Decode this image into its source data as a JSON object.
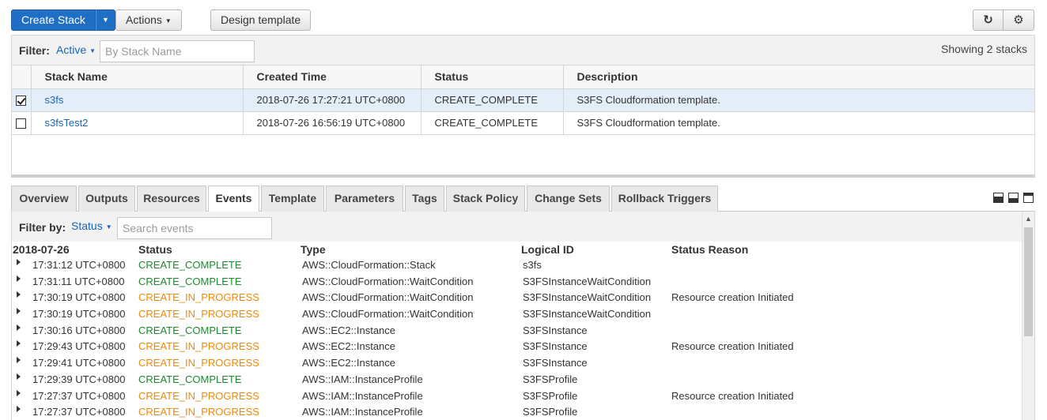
{
  "toolbar": {
    "create_stack": "Create Stack",
    "actions": "Actions",
    "design_template": "Design template"
  },
  "stacks_filter": {
    "label": "Filter:",
    "value": "Active",
    "placeholder": "By Stack Name",
    "showing": "Showing 2 stacks"
  },
  "stacks_table": {
    "columns": [
      "Stack Name",
      "Created Time",
      "Status",
      "Description"
    ],
    "rows": [
      {
        "selected": true,
        "name": "s3fs",
        "created": "2018-07-26 17:27:21 UTC+0800",
        "status": "CREATE_COMPLETE",
        "description": "S3FS Cloudformation template."
      },
      {
        "selected": false,
        "name": "s3fsTest2",
        "created": "2018-07-26 16:56:19 UTC+0800",
        "status": "CREATE_COMPLETE",
        "description": "S3FS Cloudformation template."
      }
    ]
  },
  "tabs": [
    "Overview",
    "Outputs",
    "Resources",
    "Events",
    "Template",
    "Parameters",
    "Tags",
    "Stack Policy",
    "Change Sets",
    "Rollback Triggers"
  ],
  "active_tab": "Events",
  "events_filter": {
    "label": "Filter by:",
    "value": "Status",
    "placeholder": "Search events"
  },
  "events_table": {
    "date": "2018-07-26",
    "columns": [
      "Status",
      "Type",
      "Logical ID",
      "Status Reason"
    ],
    "rows": [
      {
        "time": "17:31:12 UTC+0800",
        "status": "CREATE_COMPLETE",
        "type": "AWS::CloudFormation::Stack",
        "logical_id": "s3fs",
        "reason": ""
      },
      {
        "time": "17:31:11 UTC+0800",
        "status": "CREATE_COMPLETE",
        "type": "AWS::CloudFormation::WaitCondition",
        "logical_id": "S3FSInstanceWaitCondition",
        "reason": ""
      },
      {
        "time": "17:30:19 UTC+0800",
        "status": "CREATE_IN_PROGRESS",
        "type": "AWS::CloudFormation::WaitCondition",
        "logical_id": "S3FSInstanceWaitCondition",
        "reason": "Resource creation Initiated"
      },
      {
        "time": "17:30:19 UTC+0800",
        "status": "CREATE_IN_PROGRESS",
        "type": "AWS::CloudFormation::WaitCondition",
        "logical_id": "S3FSInstanceWaitCondition",
        "reason": ""
      },
      {
        "time": "17:30:16 UTC+0800",
        "status": "CREATE_COMPLETE",
        "type": "AWS::EC2::Instance",
        "logical_id": "S3FSInstance",
        "reason": ""
      },
      {
        "time": "17:29:43 UTC+0800",
        "status": "CREATE_IN_PROGRESS",
        "type": "AWS::EC2::Instance",
        "logical_id": "S3FSInstance",
        "reason": "Resource creation Initiated"
      },
      {
        "time": "17:29:41 UTC+0800",
        "status": "CREATE_IN_PROGRESS",
        "type": "AWS::EC2::Instance",
        "logical_id": "S3FSInstance",
        "reason": ""
      },
      {
        "time": "17:29:39 UTC+0800",
        "status": "CREATE_COMPLETE",
        "type": "AWS::IAM::InstanceProfile",
        "logical_id": "S3FSProfile",
        "reason": ""
      },
      {
        "time": "17:27:37 UTC+0800",
        "status": "CREATE_IN_PROGRESS",
        "type": "AWS::IAM::InstanceProfile",
        "logical_id": "S3FSProfile",
        "reason": "Resource creation Initiated"
      },
      {
        "time": "17:27:37 UTC+0800",
        "status": "CREATE_IN_PROGRESS",
        "type": "AWS::IAM::InstanceProfile",
        "logical_id": "S3FSProfile",
        "reason": ""
      }
    ]
  },
  "colors": {
    "primary": "#1f6fc5",
    "link": "#1a64b8",
    "complete": "#1d8a2e",
    "in_progress": "#ee8a0a",
    "selected_row": "#e3eef9"
  }
}
